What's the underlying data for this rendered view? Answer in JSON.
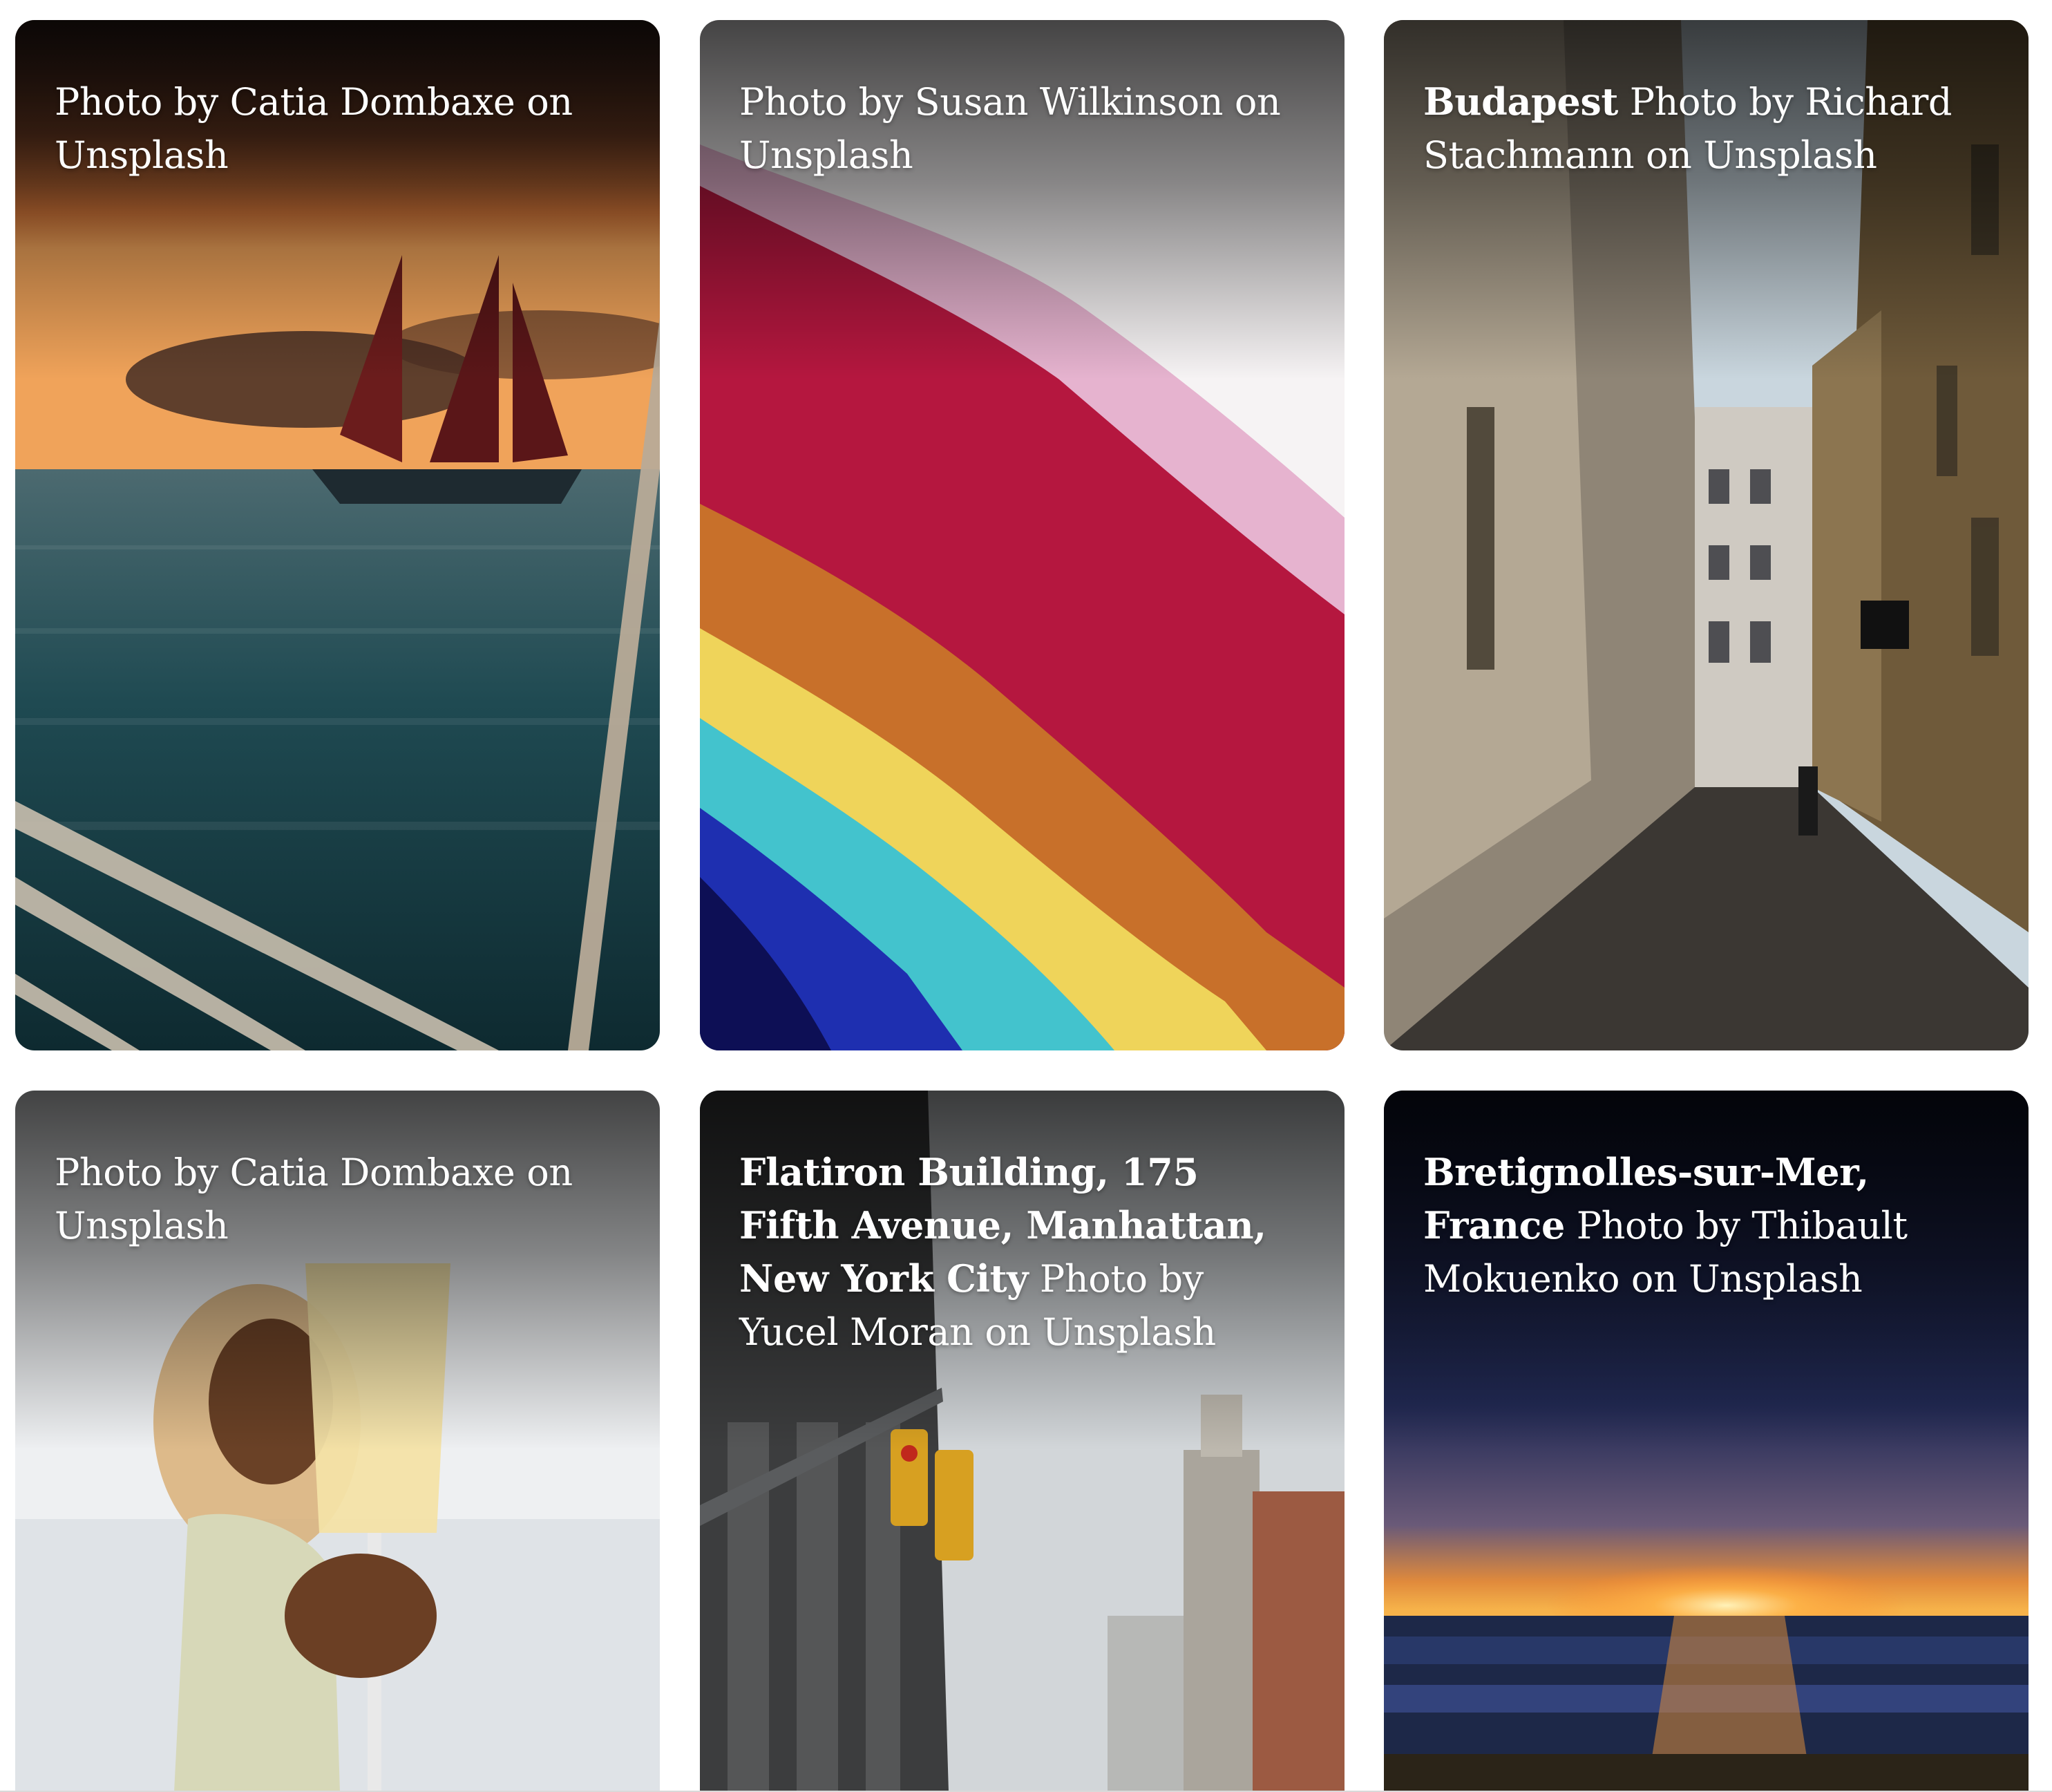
{
  "cards": [
    {
      "title": "",
      "credit": "Photo by Catia Dombaxe on Unsplash"
    },
    {
      "title": "",
      "credit": "Photo by Susan Wilkinson on Unsplash"
    },
    {
      "title": "Budapest",
      "credit": "Photo by Richard Stachmann on Unsplash"
    },
    {
      "title": "",
      "credit": "Photo by Catia Dombaxe on Unsplash"
    },
    {
      "title": "Flatiron Building, 175 Fifth Avenue, Manhattan, New York City",
      "credit": "Photo by Yucel Moran on Unsplash"
    },
    {
      "title": "Bretignolles-sur-Mer, France",
      "credit": "Photo by Thibault Mokuenko on Unsplash"
    }
  ]
}
